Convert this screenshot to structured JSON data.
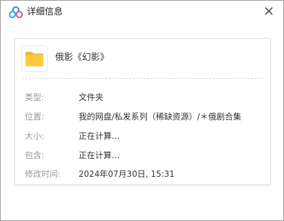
{
  "window": {
    "title": "详细信息",
    "app_icon": "baidu-netdisk-cloud-icon",
    "close_icon": "close-icon"
  },
  "item": {
    "icon": "folder-icon",
    "name": "俄影《幻影》"
  },
  "details": [
    {
      "label": "类型:",
      "value": "文件夹"
    },
    {
      "label": "位置:",
      "value": "我的网盘/私发系列（稀缺资源）/＊俄剧合集"
    },
    {
      "label": "大小:",
      "value": "正在计算..."
    },
    {
      "label": "包含:",
      "value": "正在计算..."
    },
    {
      "label": "修改时间:",
      "value": "2024年07月30日, 15:31"
    }
  ],
  "colors": {
    "folder": "#F8C33C",
    "label": "#999999",
    "value": "#333333",
    "icon_blue": "#2F80ED",
    "icon_pink": "#E85A9A"
  }
}
